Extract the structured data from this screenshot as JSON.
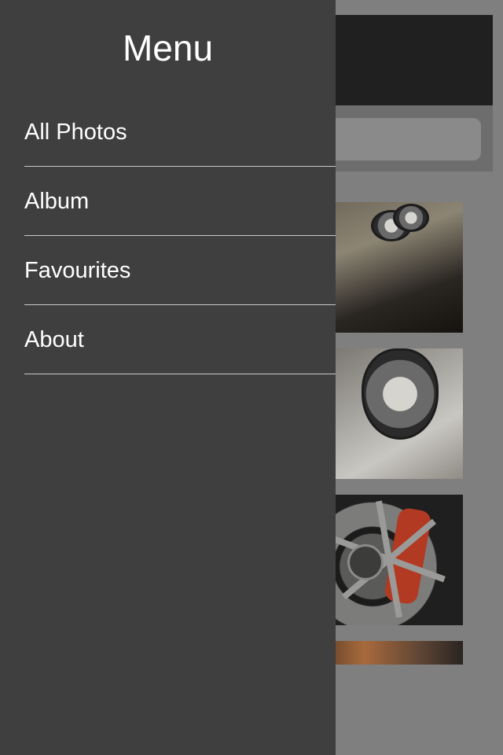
{
  "menu": {
    "title": "Menu",
    "items": [
      {
        "label": "All Photos"
      },
      {
        "label": "Album"
      },
      {
        "label": "Favourites"
      },
      {
        "label": "About"
      }
    ]
  },
  "background": {
    "photos": [
      {
        "icon": "car-headlight-photo"
      },
      {
        "icon": "white-car-headlight-photo"
      },
      {
        "icon": "wheel-brake-caliper-photo"
      },
      {
        "icon": "car-detail-photo"
      }
    ]
  },
  "colors": {
    "drawer_bg": "#3f3f3f",
    "dim_overlay": "#7f7f7f",
    "navbar_bg": "#202020",
    "text": "#ffffff",
    "divider": "#c9c9c9"
  }
}
